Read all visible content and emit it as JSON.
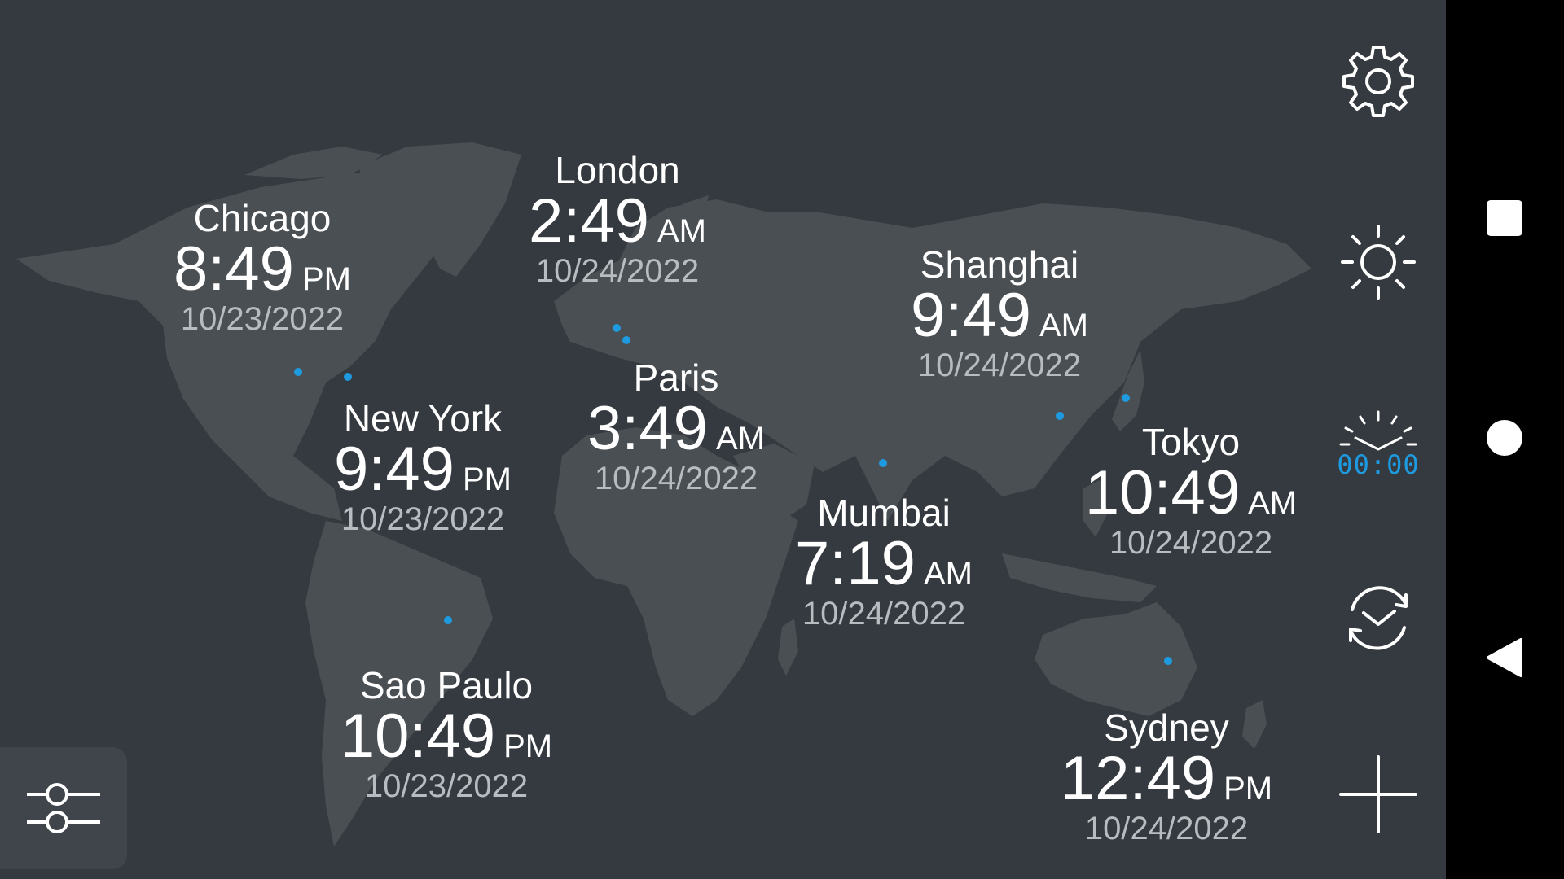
{
  "cities": [
    {
      "id": "chicago",
      "name": "Chicago",
      "time": "8:49",
      "ampm": "PM",
      "date": "10/23/2022"
    },
    {
      "id": "london",
      "name": "London",
      "time": "2:49",
      "ampm": "AM",
      "date": "10/24/2022"
    },
    {
      "id": "shanghai",
      "name": "Shanghai",
      "time": "9:49",
      "ampm": "AM",
      "date": "10/24/2022"
    },
    {
      "id": "new-york",
      "name": "New York",
      "time": "9:49",
      "ampm": "PM",
      "date": "10/23/2022"
    },
    {
      "id": "paris",
      "name": "Paris",
      "time": "3:49",
      "ampm": "AM",
      "date": "10/24/2022"
    },
    {
      "id": "tokyo",
      "name": "Tokyo",
      "time": "10:49",
      "ampm": "AM",
      "date": "10/24/2022"
    },
    {
      "id": "mumbai",
      "name": "Mumbai",
      "time": "7:19",
      "ampm": "AM",
      "date": "10/24/2022"
    },
    {
      "id": "sao-paulo",
      "name": "Sao Paulo",
      "time": "10:49",
      "ampm": "PM",
      "date": "10/23/2022"
    },
    {
      "id": "sydney",
      "name": "Sydney",
      "time": "12:49",
      "ampm": "PM",
      "date": "10/24/2022"
    }
  ],
  "digital_clock_icon_text": "00:00",
  "colors": {
    "background": "#343a3f",
    "land": "#4a4f54",
    "city_marker": "#1e9be0",
    "date_text": "#b7bcc0",
    "accent": "#1e9be0"
  },
  "icons": {
    "filter": "sliders-icon",
    "settings": "gear-icon",
    "brightness": "sun-icon",
    "clock_style": "alarm-digital-icon",
    "sync": "clock-sync-icon",
    "add": "plus-icon",
    "nav_recents": "square-icon",
    "nav_home": "circle-icon",
    "nav_back": "triangle-back-icon"
  }
}
